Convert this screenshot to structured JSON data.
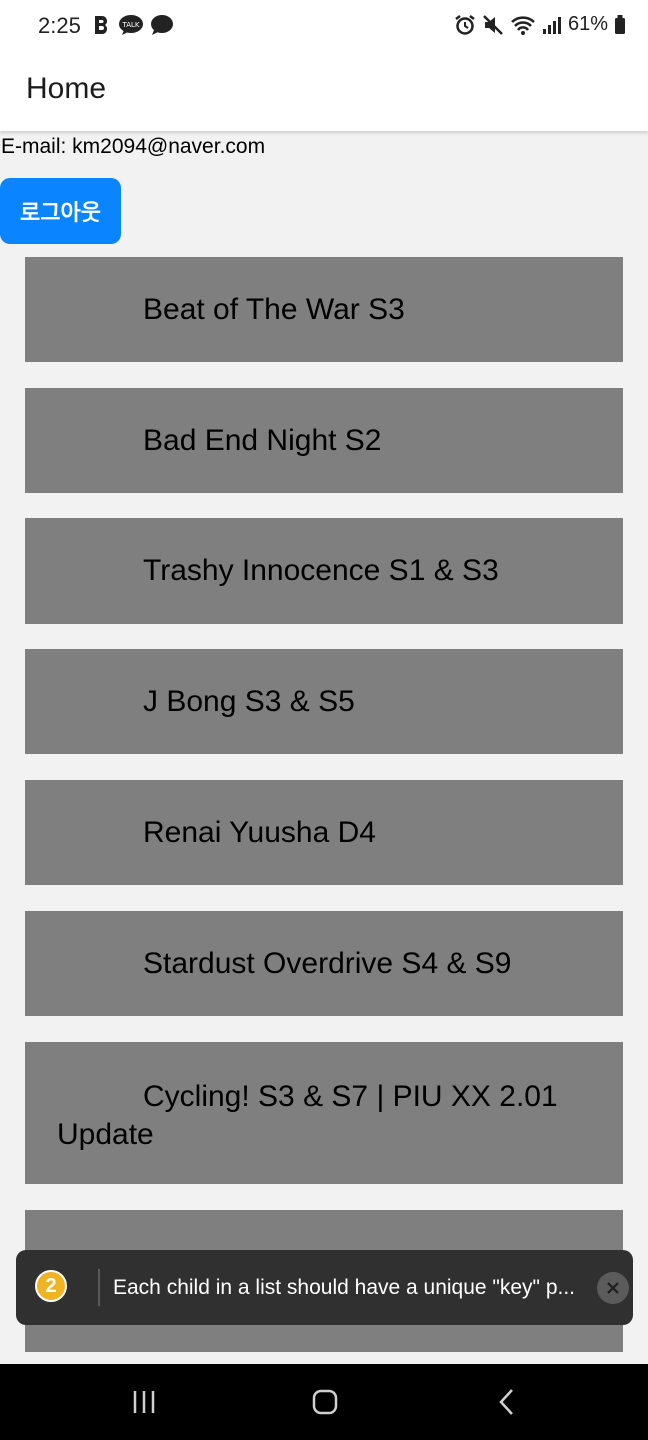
{
  "status_bar": {
    "time": "2:25",
    "battery_percent": "61%"
  },
  "appbar": {
    "title": "Home"
  },
  "account": {
    "email_line": "E-mail: km2094@naver.com",
    "logout_label": "로그아웃"
  },
  "list": {
    "items": [
      "Beat of The War S3",
      "Bad End Night S2",
      "Trashy Innocence S1 & S3",
      "J Bong S3 & S5",
      "Renai Yuusha D4",
      "Stardust Overdrive S4 & S9",
      "Cycling! S3 & S7 | PIU XX 2.01 Update",
      ""
    ]
  },
  "toast": {
    "count": "2",
    "message": "Each child in a list should have a unique \"key\" p..."
  },
  "colors": {
    "accent": "#0a84ff",
    "card": "#7f7f7f",
    "background": "#f2f2f2",
    "toast": "#303030",
    "badge": "#f0b323"
  }
}
